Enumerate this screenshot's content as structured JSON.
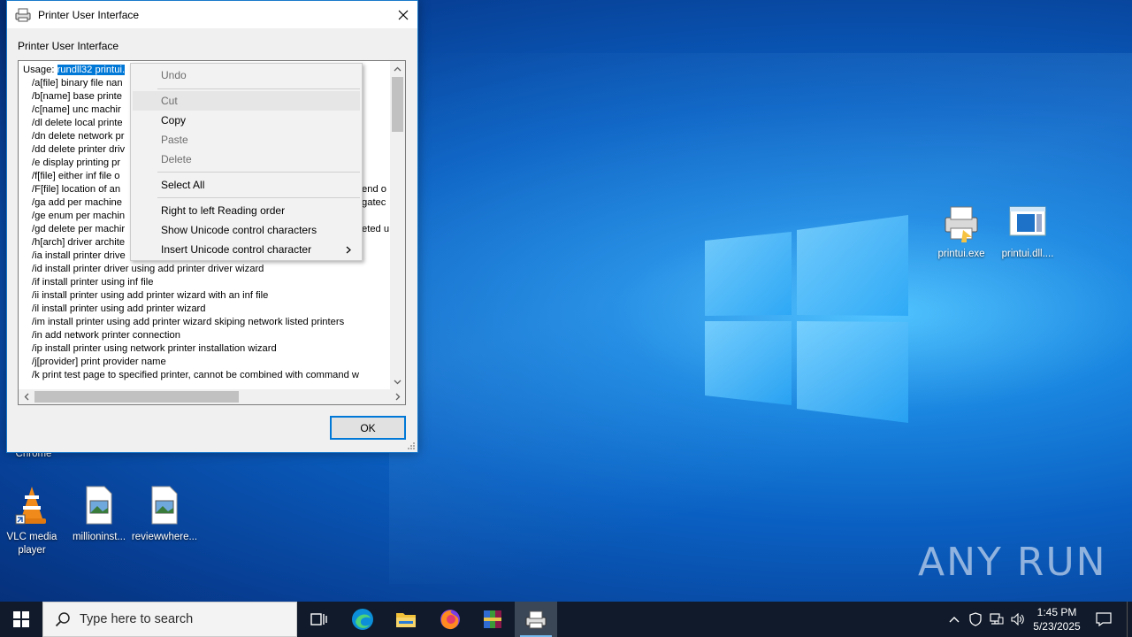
{
  "dialog": {
    "title": "Printer User Interface",
    "caption": "Printer User Interface",
    "ok_label": "OK",
    "usage_prefix": "Usage: ",
    "usage_selected": "rundll32 printui.",
    "lines": [
      "/a[file] binary file nan",
      "/b[name] base printe",
      "/c[name] unc machir",
      "/dl delete local printe",
      "/dn delete network pr",
      "/dd delete printer driv",
      "/e display printing pr",
      "/f[file] either inf file o",
      "/F[file] location of an",
      "/ga add per machine",
      "/ge enum per machin",
      "/gd delete per machir",
      "/h[arch] driver archite",
      "/ia install printer drive",
      "/id install printer driver using add printer driver wizard",
      "/if install printer using inf file",
      "/ii install printer using add printer wizard with an inf file",
      "/il install printer using add printer wizard",
      "/im install printer using add printer wizard skiping network listed printers",
      "/in add network printer connection",
      "/ip install printer using network printer installation wizard",
      "/j[provider] print provider name",
      "/k print test page to specified printer, cannot be combined with command w"
    ],
    "right_fragments": {
      "r8": "end o",
      "r9": "gatec",
      "r11": "eted u"
    }
  },
  "context_menu": {
    "undo": "Undo",
    "cut": "Cut",
    "copy": "Copy",
    "paste": "Paste",
    "delete": "Delete",
    "select_all": "Select All",
    "rtl": "Right to left Reading order",
    "show_unicode": "Show Unicode control characters",
    "insert_unicode": "Insert Unicode control character"
  },
  "desktop": {
    "icons": {
      "printui_exe": "printui.exe",
      "printui_dll": "printui.dll....",
      "chrome_partial": "Chrome",
      "vlc": "VLC media player",
      "millioninst": "millioninst...",
      "reviewwhere": "reviewwhere..."
    },
    "watermark": "ANY RUN"
  },
  "taskbar": {
    "search_placeholder": "Type here to search",
    "time": "1:45 PM",
    "date": "5/23/2025"
  },
  "colors": {
    "accent": "#0078d7",
    "taskbar_bg": "#101a2a"
  }
}
